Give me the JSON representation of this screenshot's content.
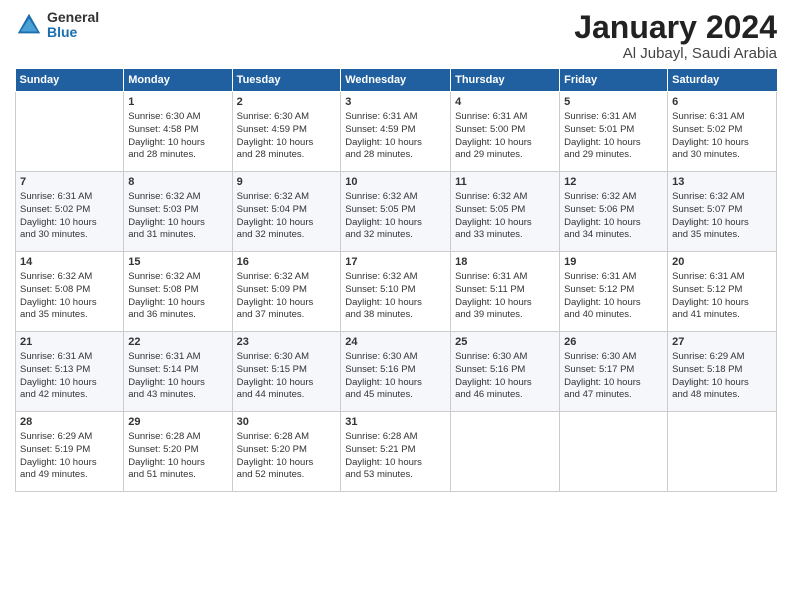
{
  "logo": {
    "general": "General",
    "blue": "Blue"
  },
  "header": {
    "title": "January 2024",
    "subtitle": "Al Jubayl, Saudi Arabia"
  },
  "columns": [
    "Sunday",
    "Monday",
    "Tuesday",
    "Wednesday",
    "Thursday",
    "Friday",
    "Saturday"
  ],
  "weeks": [
    [
      {
        "day": "",
        "content": ""
      },
      {
        "day": "1",
        "content": "Sunrise: 6:30 AM\nSunset: 4:58 PM\nDaylight: 10 hours\nand 28 minutes."
      },
      {
        "day": "2",
        "content": "Sunrise: 6:30 AM\nSunset: 4:59 PM\nDaylight: 10 hours\nand 28 minutes."
      },
      {
        "day": "3",
        "content": "Sunrise: 6:31 AM\nSunset: 4:59 PM\nDaylight: 10 hours\nand 28 minutes."
      },
      {
        "day": "4",
        "content": "Sunrise: 6:31 AM\nSunset: 5:00 PM\nDaylight: 10 hours\nand 29 minutes."
      },
      {
        "day": "5",
        "content": "Sunrise: 6:31 AM\nSunset: 5:01 PM\nDaylight: 10 hours\nand 29 minutes."
      },
      {
        "day": "6",
        "content": "Sunrise: 6:31 AM\nSunset: 5:02 PM\nDaylight: 10 hours\nand 30 minutes."
      }
    ],
    [
      {
        "day": "7",
        "content": "Sunrise: 6:31 AM\nSunset: 5:02 PM\nDaylight: 10 hours\nand 30 minutes."
      },
      {
        "day": "8",
        "content": "Sunrise: 6:32 AM\nSunset: 5:03 PM\nDaylight: 10 hours\nand 31 minutes."
      },
      {
        "day": "9",
        "content": "Sunrise: 6:32 AM\nSunset: 5:04 PM\nDaylight: 10 hours\nand 32 minutes."
      },
      {
        "day": "10",
        "content": "Sunrise: 6:32 AM\nSunset: 5:05 PM\nDaylight: 10 hours\nand 32 minutes."
      },
      {
        "day": "11",
        "content": "Sunrise: 6:32 AM\nSunset: 5:05 PM\nDaylight: 10 hours\nand 33 minutes."
      },
      {
        "day": "12",
        "content": "Sunrise: 6:32 AM\nSunset: 5:06 PM\nDaylight: 10 hours\nand 34 minutes."
      },
      {
        "day": "13",
        "content": "Sunrise: 6:32 AM\nSunset: 5:07 PM\nDaylight: 10 hours\nand 35 minutes."
      }
    ],
    [
      {
        "day": "14",
        "content": "Sunrise: 6:32 AM\nSunset: 5:08 PM\nDaylight: 10 hours\nand 35 minutes."
      },
      {
        "day": "15",
        "content": "Sunrise: 6:32 AM\nSunset: 5:08 PM\nDaylight: 10 hours\nand 36 minutes."
      },
      {
        "day": "16",
        "content": "Sunrise: 6:32 AM\nSunset: 5:09 PM\nDaylight: 10 hours\nand 37 minutes."
      },
      {
        "day": "17",
        "content": "Sunrise: 6:32 AM\nSunset: 5:10 PM\nDaylight: 10 hours\nand 38 minutes."
      },
      {
        "day": "18",
        "content": "Sunrise: 6:31 AM\nSunset: 5:11 PM\nDaylight: 10 hours\nand 39 minutes."
      },
      {
        "day": "19",
        "content": "Sunrise: 6:31 AM\nSunset: 5:12 PM\nDaylight: 10 hours\nand 40 minutes."
      },
      {
        "day": "20",
        "content": "Sunrise: 6:31 AM\nSunset: 5:12 PM\nDaylight: 10 hours\nand 41 minutes."
      }
    ],
    [
      {
        "day": "21",
        "content": "Sunrise: 6:31 AM\nSunset: 5:13 PM\nDaylight: 10 hours\nand 42 minutes."
      },
      {
        "day": "22",
        "content": "Sunrise: 6:31 AM\nSunset: 5:14 PM\nDaylight: 10 hours\nand 43 minutes."
      },
      {
        "day": "23",
        "content": "Sunrise: 6:30 AM\nSunset: 5:15 PM\nDaylight: 10 hours\nand 44 minutes."
      },
      {
        "day": "24",
        "content": "Sunrise: 6:30 AM\nSunset: 5:16 PM\nDaylight: 10 hours\nand 45 minutes."
      },
      {
        "day": "25",
        "content": "Sunrise: 6:30 AM\nSunset: 5:16 PM\nDaylight: 10 hours\nand 46 minutes."
      },
      {
        "day": "26",
        "content": "Sunrise: 6:30 AM\nSunset: 5:17 PM\nDaylight: 10 hours\nand 47 minutes."
      },
      {
        "day": "27",
        "content": "Sunrise: 6:29 AM\nSunset: 5:18 PM\nDaylight: 10 hours\nand 48 minutes."
      }
    ],
    [
      {
        "day": "28",
        "content": "Sunrise: 6:29 AM\nSunset: 5:19 PM\nDaylight: 10 hours\nand 49 minutes."
      },
      {
        "day": "29",
        "content": "Sunrise: 6:28 AM\nSunset: 5:20 PM\nDaylight: 10 hours\nand 51 minutes."
      },
      {
        "day": "30",
        "content": "Sunrise: 6:28 AM\nSunset: 5:20 PM\nDaylight: 10 hours\nand 52 minutes."
      },
      {
        "day": "31",
        "content": "Sunrise: 6:28 AM\nSunset: 5:21 PM\nDaylight: 10 hours\nand 53 minutes."
      },
      {
        "day": "",
        "content": ""
      },
      {
        "day": "",
        "content": ""
      },
      {
        "day": "",
        "content": ""
      }
    ]
  ]
}
